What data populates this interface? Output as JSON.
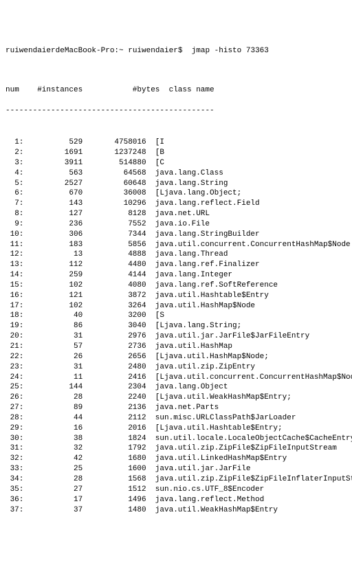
{
  "prompt": {
    "host": "ruiwendaierdeMacBook-Pro:~ ruiwendaier$ ",
    "command": " jmap -histo 73363"
  },
  "headers": {
    "num": "num",
    "instances": "#instances",
    "bytes": "#bytes",
    "class": "class name"
  },
  "separator": "----------------------------------------------",
  "rows": [
    {
      "n": "1:",
      "inst": "529",
      "bytes": "4758016",
      "cls": "[I"
    },
    {
      "n": "2:",
      "inst": "1691",
      "bytes": "1237248",
      "cls": "[B"
    },
    {
      "n": "3:",
      "inst": "3911",
      "bytes": "514880",
      "cls": "[C"
    },
    {
      "n": "4:",
      "inst": "563",
      "bytes": "64568",
      "cls": "java.lang.Class"
    },
    {
      "n": "5:",
      "inst": "2527",
      "bytes": "60648",
      "cls": "java.lang.String"
    },
    {
      "n": "6:",
      "inst": "670",
      "bytes": "36008",
      "cls": "[Ljava.lang.Object;"
    },
    {
      "n": "7:",
      "inst": "143",
      "bytes": "10296",
      "cls": "java.lang.reflect.Field"
    },
    {
      "n": "8:",
      "inst": "127",
      "bytes": "8128",
      "cls": "java.net.URL"
    },
    {
      "n": "9:",
      "inst": "236",
      "bytes": "7552",
      "cls": "java.io.File"
    },
    {
      "n": "10:",
      "inst": "306",
      "bytes": "7344",
      "cls": "java.lang.StringBuilder"
    },
    {
      "n": "11:",
      "inst": "183",
      "bytes": "5856",
      "cls": "java.util.concurrent.ConcurrentHashMap$Node"
    },
    {
      "n": "12:",
      "inst": "13",
      "bytes": "4888",
      "cls": "java.lang.Thread"
    },
    {
      "n": "13:",
      "inst": "112",
      "bytes": "4480",
      "cls": "java.lang.ref.Finalizer"
    },
    {
      "n": "14:",
      "inst": "259",
      "bytes": "4144",
      "cls": "java.lang.Integer"
    },
    {
      "n": "15:",
      "inst": "102",
      "bytes": "4080",
      "cls": "java.lang.ref.SoftReference"
    },
    {
      "n": "16:",
      "inst": "121",
      "bytes": "3872",
      "cls": "java.util.Hashtable$Entry"
    },
    {
      "n": "17:",
      "inst": "102",
      "bytes": "3264",
      "cls": "java.util.HashMap$Node"
    },
    {
      "n": "18:",
      "inst": "40",
      "bytes": "3200",
      "cls": "[S"
    },
    {
      "n": "19:",
      "inst": "86",
      "bytes": "3040",
      "cls": "[Ljava.lang.String;"
    },
    {
      "n": "20:",
      "inst": "31",
      "bytes": "2976",
      "cls": "java.util.jar.JarFile$JarFileEntry"
    },
    {
      "n": "21:",
      "inst": "57",
      "bytes": "2736",
      "cls": "java.util.HashMap"
    },
    {
      "n": "22:",
      "inst": "26",
      "bytes": "2656",
      "cls": "[Ljava.util.HashMap$Node;"
    },
    {
      "n": "23:",
      "inst": "31",
      "bytes": "2480",
      "cls": "java.util.zip.ZipEntry"
    },
    {
      "n": "24:",
      "inst": "11",
      "bytes": "2416",
      "cls": "[Ljava.util.concurrent.ConcurrentHashMap$Node;"
    },
    {
      "n": "25:",
      "inst": "144",
      "bytes": "2304",
      "cls": "java.lang.Object"
    },
    {
      "n": "26:",
      "inst": "28",
      "bytes": "2240",
      "cls": "[Ljava.util.WeakHashMap$Entry;"
    },
    {
      "n": "27:",
      "inst": "89",
      "bytes": "2136",
      "cls": "java.net.Parts"
    },
    {
      "n": "28:",
      "inst": "44",
      "bytes": "2112",
      "cls": "sun.misc.URLClassPath$JarLoader"
    },
    {
      "n": "29:",
      "inst": "16",
      "bytes": "2016",
      "cls": "[Ljava.util.Hashtable$Entry;"
    },
    {
      "n": "30:",
      "inst": "38",
      "bytes": "1824",
      "cls": "sun.util.locale.LocaleObjectCache$CacheEntry"
    },
    {
      "n": "31:",
      "inst": "32",
      "bytes": "1792",
      "cls": "java.util.zip.ZipFile$ZipFileInputStream"
    },
    {
      "n": "32:",
      "inst": "42",
      "bytes": "1680",
      "cls": "java.util.LinkedHashMap$Entry"
    },
    {
      "n": "33:",
      "inst": "25",
      "bytes": "1600",
      "cls": "java.util.jar.JarFile"
    },
    {
      "n": "34:",
      "inst": "28",
      "bytes": "1568",
      "cls": "java.util.zip.ZipFile$ZipFileInflaterInputStream"
    },
    {
      "n": "35:",
      "inst": "27",
      "bytes": "1512",
      "cls": "sun.nio.cs.UTF_8$Encoder"
    },
    {
      "n": "36:",
      "inst": "17",
      "bytes": "1496",
      "cls": "java.lang.reflect.Method"
    },
    {
      "n": "37:",
      "inst": "37",
      "bytes": "1480",
      "cls": "java.util.WeakHashMap$Entry"
    }
  ]
}
